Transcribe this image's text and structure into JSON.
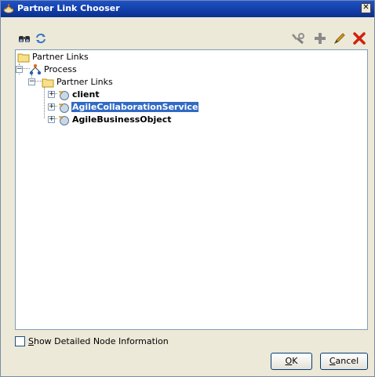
{
  "window": {
    "title": "Partner Link Chooser",
    "close_glyph": "✕"
  },
  "toolbar": {
    "left_icons": [
      "binoculars-icon",
      "refresh-icon"
    ],
    "right_icons": [
      "wrench-icon",
      "add-icon",
      "edit-pencil-icon",
      "delete-x-icon"
    ]
  },
  "tree": {
    "root": {
      "label": "Partner Links",
      "icon": "folder-icon"
    },
    "process": {
      "label": "Process",
      "icon": "process-icon",
      "expander": "−"
    },
    "group": {
      "label": "Partner Links",
      "icon": "folder-icon",
      "expander": "−"
    },
    "items": [
      {
        "label": "client",
        "selected": false,
        "expander": "+"
      },
      {
        "label": "AgileCollaborationService",
        "selected": true,
        "expander": "+"
      },
      {
        "label": "AgileBusinessObject",
        "selected": false,
        "expander": "+"
      }
    ]
  },
  "footer": {
    "show_detailed_label_prefix": "S",
    "show_detailed_label_rest": "how Detailed Node Information",
    "show_detailed_checked": false,
    "ok_prefix": "O",
    "ok_rest": "K",
    "cancel_prefix": "C",
    "cancel_rest": "ancel"
  },
  "colors": {
    "selection": "#316ac5",
    "dialog_bg": "#ece9d8",
    "titlebar": "#0a2f8f"
  }
}
